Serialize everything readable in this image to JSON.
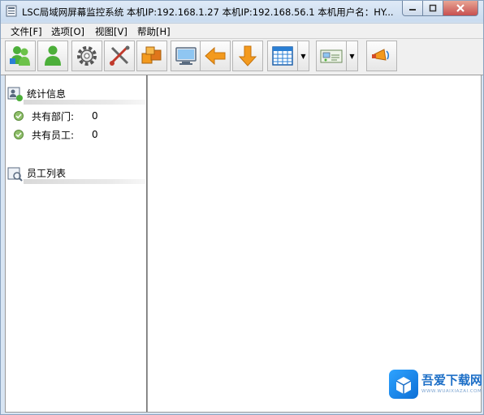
{
  "window": {
    "title": "LSC局域网屏幕监控系统    本机IP:192.168.1.27   本机IP:192.168.56.1    本机用户名：HY..."
  },
  "menu": [
    {
      "label": "文件[F]"
    },
    {
      "label": "选项[O]"
    },
    {
      "label": "视图[V]"
    },
    {
      "label": "帮助[H]"
    }
  ],
  "toolbar": {
    "buttons": [
      {
        "icon": "users-add-icon"
      },
      {
        "icon": "user-icon"
      },
      {
        "icon": "gear-icon"
      },
      {
        "icon": "tools-icon"
      },
      {
        "icon": "boxes-icon"
      },
      {
        "icon": "monitor-icon"
      },
      {
        "icon": "arrow-left-icon"
      },
      {
        "icon": "arrow-down-icon"
      },
      {
        "icon": "grid-icon"
      },
      {
        "icon": "network-icon"
      },
      {
        "icon": "megaphone-icon"
      }
    ]
  },
  "left_panel": {
    "stats_section": {
      "title": "统计信息",
      "rows": [
        {
          "label": "共有部门:",
          "value": "0"
        },
        {
          "label": "共有员工:",
          "value": "0"
        }
      ]
    },
    "employees_section": {
      "title": "员工列表"
    }
  },
  "watermark": {
    "text": "吾爱下载网",
    "sub": "WWW.WUAIXIAZAI.COM"
  },
  "colors": {
    "accent_green": "#4caf3a",
    "accent_orange": "#f39a1e",
    "accent_blue": "#1d6fc7"
  }
}
